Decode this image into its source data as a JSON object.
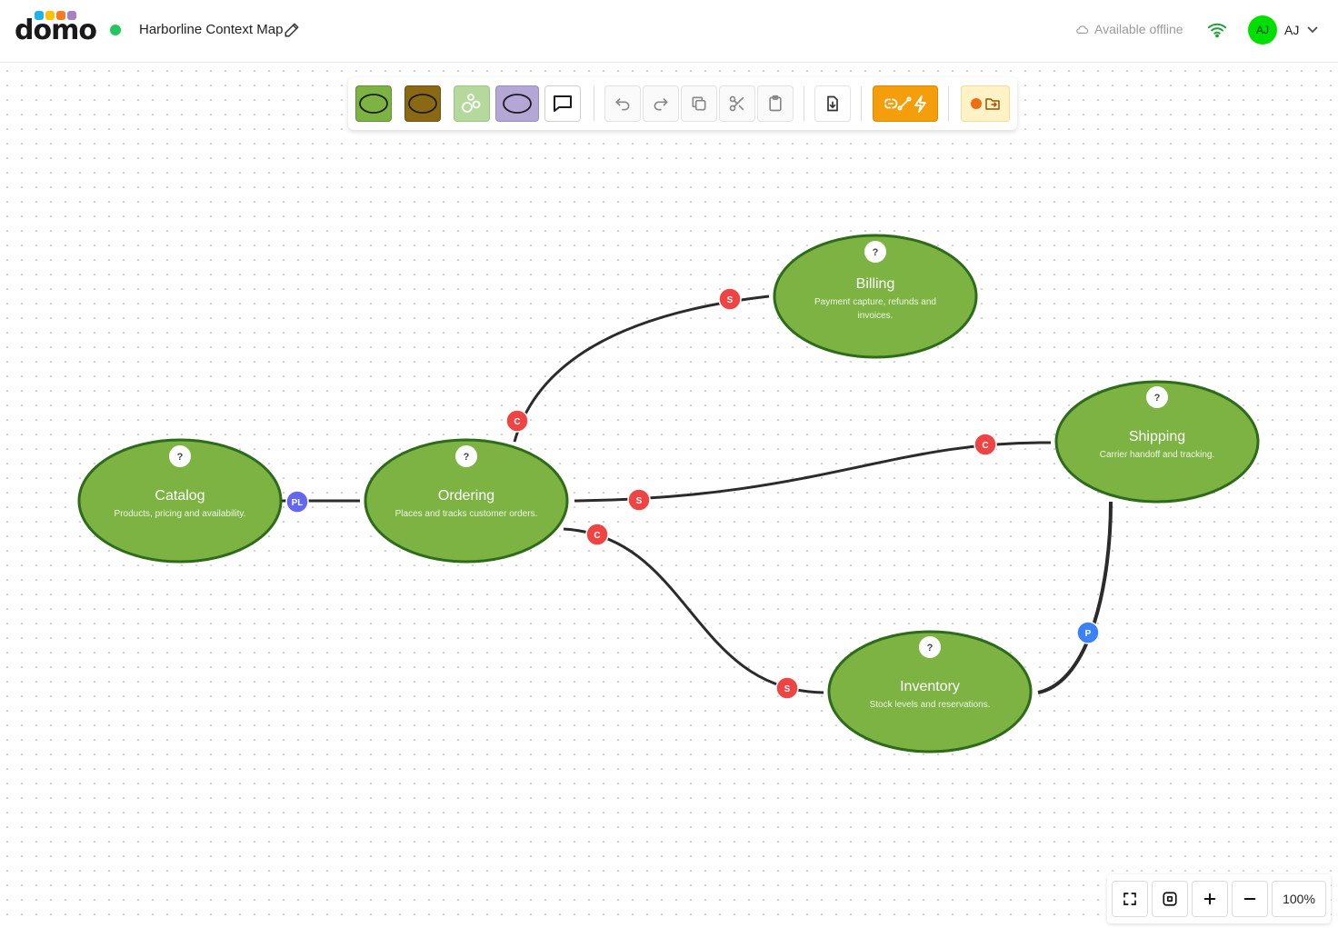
{
  "app": {
    "logo_text": "domo",
    "logo_colors": [
      "#1fb3e8",
      "#ffc107",
      "#f57c20",
      "#a97fc4"
    ],
    "status_color": "#22c55e",
    "title": "Harborline Context Map",
    "offline_label": "Available offline",
    "user": {
      "initials": "AJ",
      "name": "AJ",
      "avatar_color": "#00e000"
    }
  },
  "toolbar": {
    "tools": [
      {
        "name": "bounded-context-green",
        "icon": "ellipse-icon",
        "fill": "#7cb342"
      },
      {
        "name": "bounded-context-brown",
        "icon": "ellipse-icon",
        "fill": "#8b6914"
      },
      {
        "name": "aggregate-light-green",
        "icon": "bubbles-icon",
        "fill": "#b5d99c"
      },
      {
        "name": "bounded-context-lavender",
        "icon": "ellipse-icon",
        "fill": "#b4a7d6"
      },
      {
        "name": "comment",
        "icon": "speech-bubble-icon",
        "fill": "#ffffff"
      }
    ],
    "actions": [
      "undo-icon",
      "redo-icon",
      "copy-icon",
      "cut-icon",
      "paste-icon",
      "import-icon",
      "link-tools-icon",
      "folder-import-icon"
    ],
    "accent_color": "#f59e0b"
  },
  "contexts": [
    {
      "id": "catalog",
      "name": "Catalog",
      "description": "Products, pricing and availability.",
      "badge": "?"
    },
    {
      "id": "ordering",
      "name": "Ordering",
      "description": "Places and tracks customer orders.",
      "badge": "?"
    },
    {
      "id": "billing",
      "name": "Billing",
      "description": "Payment capture, refunds and invoices.",
      "badge": "?"
    },
    {
      "id": "shipping",
      "name": "Shipping",
      "description": "Carrier handoff and tracking.",
      "badge": "?"
    },
    {
      "id": "inventory",
      "name": "Inventory",
      "description": "Stock levels and reservations.",
      "badge": "?"
    }
  ],
  "relationships": [
    {
      "from": "catalog",
      "to": "ordering",
      "labels": [
        "PL"
      ]
    },
    {
      "from": "ordering",
      "to": "billing",
      "labels": [
        "C",
        "S"
      ]
    },
    {
      "from": "ordering",
      "to": "shipping",
      "labels": [
        "S",
        "C"
      ]
    },
    {
      "from": "ordering",
      "to": "inventory",
      "labels": [
        "C",
        "S"
      ]
    },
    {
      "from": "inventory",
      "to": "shipping",
      "labels": [
        "P"
      ]
    }
  ],
  "colors": {
    "context_fill": "#7cb342",
    "context_stroke": "#2e6b1a",
    "edge": "#2b2b2b",
    "badge_red": "#ef4444",
    "badge_indigo": "#6366f1",
    "badge_blue": "#3b82f6"
  },
  "zoom": {
    "level": "100%"
  }
}
